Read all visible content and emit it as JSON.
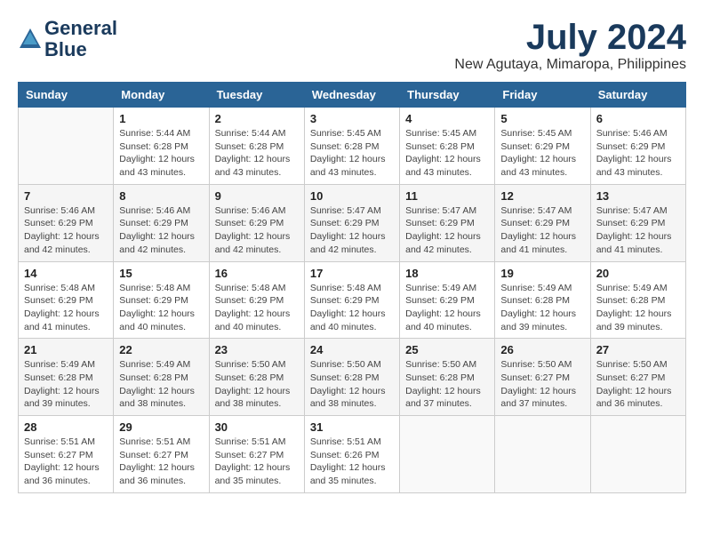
{
  "header": {
    "logo_line1": "General",
    "logo_line2": "Blue",
    "month": "July 2024",
    "location": "New Agutaya, Mimaropa, Philippines"
  },
  "days_of_week": [
    "Sunday",
    "Monday",
    "Tuesday",
    "Wednesday",
    "Thursday",
    "Friday",
    "Saturday"
  ],
  "weeks": [
    [
      {
        "day": "",
        "sunrise": "",
        "sunset": "",
        "daylight": "",
        "empty": true
      },
      {
        "day": "1",
        "sunrise": "Sunrise: 5:44 AM",
        "sunset": "Sunset: 6:28 PM",
        "daylight": "Daylight: 12 hours and 43 minutes."
      },
      {
        "day": "2",
        "sunrise": "Sunrise: 5:44 AM",
        "sunset": "Sunset: 6:28 PM",
        "daylight": "Daylight: 12 hours and 43 minutes."
      },
      {
        "day": "3",
        "sunrise": "Sunrise: 5:45 AM",
        "sunset": "Sunset: 6:28 PM",
        "daylight": "Daylight: 12 hours and 43 minutes."
      },
      {
        "day": "4",
        "sunrise": "Sunrise: 5:45 AM",
        "sunset": "Sunset: 6:28 PM",
        "daylight": "Daylight: 12 hours and 43 minutes."
      },
      {
        "day": "5",
        "sunrise": "Sunrise: 5:45 AM",
        "sunset": "Sunset: 6:29 PM",
        "daylight": "Daylight: 12 hours and 43 minutes."
      },
      {
        "day": "6",
        "sunrise": "Sunrise: 5:46 AM",
        "sunset": "Sunset: 6:29 PM",
        "daylight": "Daylight: 12 hours and 43 minutes."
      }
    ],
    [
      {
        "day": "7",
        "sunrise": "Sunrise: 5:46 AM",
        "sunset": "Sunset: 6:29 PM",
        "daylight": "Daylight: 12 hours and 42 minutes."
      },
      {
        "day": "8",
        "sunrise": "Sunrise: 5:46 AM",
        "sunset": "Sunset: 6:29 PM",
        "daylight": "Daylight: 12 hours and 42 minutes."
      },
      {
        "day": "9",
        "sunrise": "Sunrise: 5:46 AM",
        "sunset": "Sunset: 6:29 PM",
        "daylight": "Daylight: 12 hours and 42 minutes."
      },
      {
        "day": "10",
        "sunrise": "Sunrise: 5:47 AM",
        "sunset": "Sunset: 6:29 PM",
        "daylight": "Daylight: 12 hours and 42 minutes."
      },
      {
        "day": "11",
        "sunrise": "Sunrise: 5:47 AM",
        "sunset": "Sunset: 6:29 PM",
        "daylight": "Daylight: 12 hours and 42 minutes."
      },
      {
        "day": "12",
        "sunrise": "Sunrise: 5:47 AM",
        "sunset": "Sunset: 6:29 PM",
        "daylight": "Daylight: 12 hours and 41 minutes."
      },
      {
        "day": "13",
        "sunrise": "Sunrise: 5:47 AM",
        "sunset": "Sunset: 6:29 PM",
        "daylight": "Daylight: 12 hours and 41 minutes."
      }
    ],
    [
      {
        "day": "14",
        "sunrise": "Sunrise: 5:48 AM",
        "sunset": "Sunset: 6:29 PM",
        "daylight": "Daylight: 12 hours and 41 minutes."
      },
      {
        "day": "15",
        "sunrise": "Sunrise: 5:48 AM",
        "sunset": "Sunset: 6:29 PM",
        "daylight": "Daylight: 12 hours and 40 minutes."
      },
      {
        "day": "16",
        "sunrise": "Sunrise: 5:48 AM",
        "sunset": "Sunset: 6:29 PM",
        "daylight": "Daylight: 12 hours and 40 minutes."
      },
      {
        "day": "17",
        "sunrise": "Sunrise: 5:48 AM",
        "sunset": "Sunset: 6:29 PM",
        "daylight": "Daylight: 12 hours and 40 minutes."
      },
      {
        "day": "18",
        "sunrise": "Sunrise: 5:49 AM",
        "sunset": "Sunset: 6:29 PM",
        "daylight": "Daylight: 12 hours and 40 minutes."
      },
      {
        "day": "19",
        "sunrise": "Sunrise: 5:49 AM",
        "sunset": "Sunset: 6:28 PM",
        "daylight": "Daylight: 12 hours and 39 minutes."
      },
      {
        "day": "20",
        "sunrise": "Sunrise: 5:49 AM",
        "sunset": "Sunset: 6:28 PM",
        "daylight": "Daylight: 12 hours and 39 minutes."
      }
    ],
    [
      {
        "day": "21",
        "sunrise": "Sunrise: 5:49 AM",
        "sunset": "Sunset: 6:28 PM",
        "daylight": "Daylight: 12 hours and 39 minutes."
      },
      {
        "day": "22",
        "sunrise": "Sunrise: 5:49 AM",
        "sunset": "Sunset: 6:28 PM",
        "daylight": "Daylight: 12 hours and 38 minutes."
      },
      {
        "day": "23",
        "sunrise": "Sunrise: 5:50 AM",
        "sunset": "Sunset: 6:28 PM",
        "daylight": "Daylight: 12 hours and 38 minutes."
      },
      {
        "day": "24",
        "sunrise": "Sunrise: 5:50 AM",
        "sunset": "Sunset: 6:28 PM",
        "daylight": "Daylight: 12 hours and 38 minutes."
      },
      {
        "day": "25",
        "sunrise": "Sunrise: 5:50 AM",
        "sunset": "Sunset: 6:28 PM",
        "daylight": "Daylight: 12 hours and 37 minutes."
      },
      {
        "day": "26",
        "sunrise": "Sunrise: 5:50 AM",
        "sunset": "Sunset: 6:27 PM",
        "daylight": "Daylight: 12 hours and 37 minutes."
      },
      {
        "day": "27",
        "sunrise": "Sunrise: 5:50 AM",
        "sunset": "Sunset: 6:27 PM",
        "daylight": "Daylight: 12 hours and 36 minutes."
      }
    ],
    [
      {
        "day": "28",
        "sunrise": "Sunrise: 5:51 AM",
        "sunset": "Sunset: 6:27 PM",
        "daylight": "Daylight: 12 hours and 36 minutes."
      },
      {
        "day": "29",
        "sunrise": "Sunrise: 5:51 AM",
        "sunset": "Sunset: 6:27 PM",
        "daylight": "Daylight: 12 hours and 36 minutes."
      },
      {
        "day": "30",
        "sunrise": "Sunrise: 5:51 AM",
        "sunset": "Sunset: 6:27 PM",
        "daylight": "Daylight: 12 hours and 35 minutes."
      },
      {
        "day": "31",
        "sunrise": "Sunrise: 5:51 AM",
        "sunset": "Sunset: 6:26 PM",
        "daylight": "Daylight: 12 hours and 35 minutes."
      },
      {
        "day": "",
        "sunrise": "",
        "sunset": "",
        "daylight": "",
        "empty": true
      },
      {
        "day": "",
        "sunrise": "",
        "sunset": "",
        "daylight": "",
        "empty": true
      },
      {
        "day": "",
        "sunrise": "",
        "sunset": "",
        "daylight": "",
        "empty": true
      }
    ]
  ]
}
